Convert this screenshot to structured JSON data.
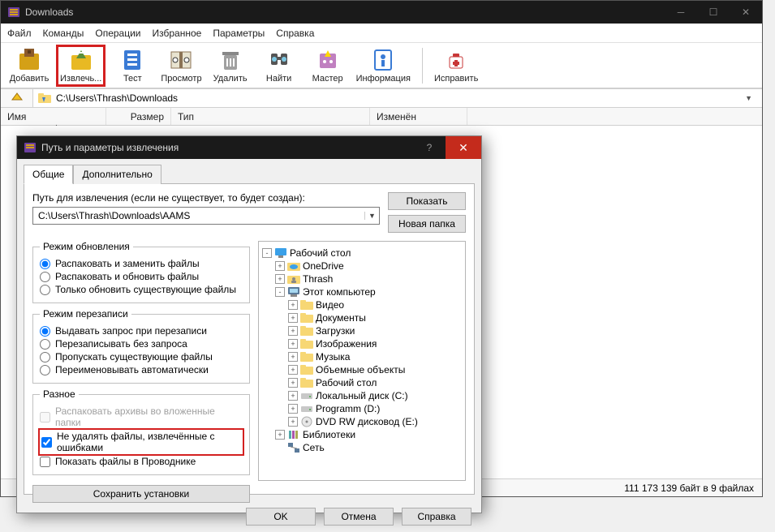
{
  "main": {
    "title": "Downloads",
    "menu": [
      "Файл",
      "Команды",
      "Операции",
      "Избранное",
      "Параметры",
      "Справка"
    ],
    "toolbar": [
      {
        "label": "Добавить",
        "icon": "box"
      },
      {
        "label": "Извлечь...",
        "icon": "open-box",
        "highlighted": true
      },
      {
        "label": "Тест",
        "icon": "stack"
      },
      {
        "label": "Просмотр",
        "icon": "book"
      },
      {
        "label": "Удалить",
        "icon": "delete"
      },
      {
        "label": "Найти",
        "icon": "search"
      },
      {
        "label": "Мастер",
        "icon": "wizard"
      },
      {
        "label": "Информация",
        "icon": "info"
      },
      {
        "label": "Исправить",
        "icon": "repair"
      }
    ],
    "path": "C:\\Users\\Thrash\\Downloads",
    "columns": [
      "Имя",
      "Размер",
      "Тип",
      "Изменён"
    ],
    "statusbar": "111 173 139 байт в 9 файлах"
  },
  "dialog": {
    "title": "Путь и параметры извлечения",
    "tabs": [
      "Общие",
      "Дополнительно"
    ],
    "path_label": "Путь для извлечения (если не существует, то будет создан):",
    "path_value": "C:\\Users\\Thrash\\Downloads\\AAMS",
    "btn_show": "Показать",
    "btn_newfolder": "Новая папка",
    "groups": {
      "update": {
        "title": "Режим обновления",
        "opts": [
          "Распаковать и заменить файлы",
          "Распаковать и обновить файлы",
          "Только обновить существующие файлы"
        ],
        "selected": 0
      },
      "overwrite": {
        "title": "Режим перезаписи",
        "opts": [
          "Выдавать запрос при перезаписи",
          "Перезаписывать без запроса",
          "Пропускать существующие файлы",
          "Переименовывать автоматически"
        ],
        "selected": 0
      },
      "misc": {
        "title": "Разное",
        "opts": [
          "Распаковать архивы во вложенные папки",
          "Не удалять файлы, извлечённые с ошибками",
          "Показать файлы в Проводнике"
        ]
      }
    },
    "tree": [
      {
        "level": 0,
        "exp": "-",
        "icon": "desktop",
        "label": "Рабочий стол"
      },
      {
        "level": 1,
        "exp": "+",
        "icon": "folder-cloud",
        "label": "OneDrive"
      },
      {
        "level": 1,
        "exp": "+",
        "icon": "folder-user",
        "label": "Thrash"
      },
      {
        "level": 1,
        "exp": "-",
        "icon": "computer",
        "label": "Этот компьютер"
      },
      {
        "level": 2,
        "exp": "+",
        "icon": "folder",
        "label": "Видео"
      },
      {
        "level": 2,
        "exp": "+",
        "icon": "folder",
        "label": "Документы"
      },
      {
        "level": 2,
        "exp": "+",
        "icon": "folder",
        "label": "Загрузки"
      },
      {
        "level": 2,
        "exp": "+",
        "icon": "folder",
        "label": "Изображения"
      },
      {
        "level": 2,
        "exp": "+",
        "icon": "folder",
        "label": "Музыка"
      },
      {
        "level": 2,
        "exp": "+",
        "icon": "folder",
        "label": "Объемные объекты"
      },
      {
        "level": 2,
        "exp": "+",
        "icon": "folder",
        "label": "Рабочий стол"
      },
      {
        "level": 2,
        "exp": "+",
        "icon": "drive",
        "label": "Локальный диск (C:)"
      },
      {
        "level": 2,
        "exp": "+",
        "icon": "drive",
        "label": "Programm (D:)"
      },
      {
        "level": 2,
        "exp": "+",
        "icon": "disc",
        "label": "DVD RW дисковод (E:)"
      },
      {
        "level": 1,
        "exp": "+",
        "icon": "library",
        "label": "Библиотеки"
      },
      {
        "level": 1,
        "exp": "",
        "icon": "network",
        "label": "Сеть"
      }
    ],
    "btn_save": "Сохранить установки",
    "footer": [
      "OK",
      "Отмена",
      "Справка"
    ]
  }
}
